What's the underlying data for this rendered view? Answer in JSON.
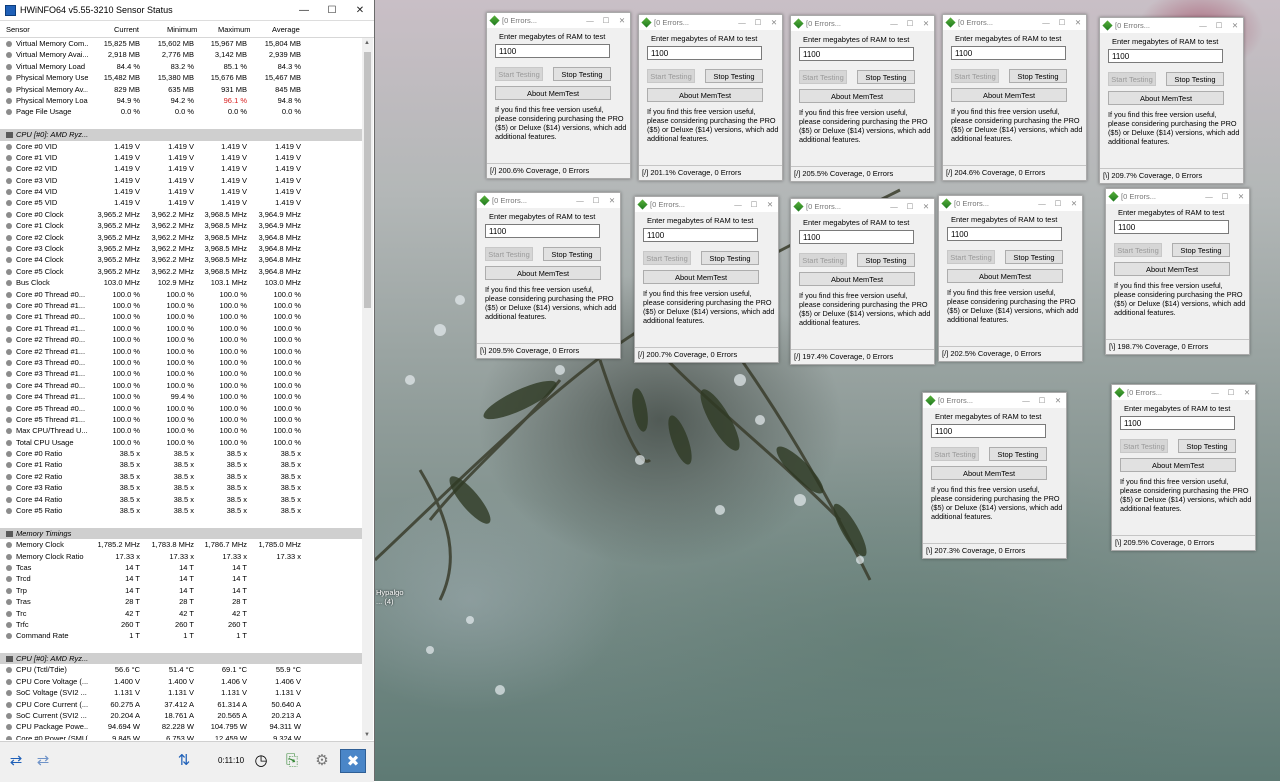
{
  "hwinfo": {
    "title": "HWiNFO64 v5.55-3210 Sensor Status",
    "columns": [
      "Sensor",
      "Current",
      "Minimum",
      "Maximum",
      "Average"
    ],
    "elapsed": "0:11:10",
    "highlight_color": "#d81e1e",
    "rows": [
      {
        "type": "sensor",
        "name": "Virtual Memory Com...",
        "cur": "15,825 MB",
        "min": "15,602 MB",
        "max": "15,967 MB",
        "avg": "15,804 MB"
      },
      {
        "type": "sensor",
        "name": "Virtual Memory Avai...",
        "cur": "2,918 MB",
        "min": "2,776 MB",
        "max": "3,142 MB",
        "avg": "2,939 MB"
      },
      {
        "type": "sensor",
        "name": "Virtual Memory Load",
        "cur": "84.4 %",
        "min": "83.2 %",
        "max": "85.1 %",
        "avg": "84.3 %"
      },
      {
        "type": "sensor",
        "name": "Physical Memory Used",
        "cur": "15,482 MB",
        "min": "15,380 MB",
        "max": "15,676 MB",
        "avg": "15,467 MB"
      },
      {
        "type": "sensor",
        "name": "Physical Memory Av...",
        "cur": "829 MB",
        "min": "635 MB",
        "max": "931 MB",
        "avg": "845 MB"
      },
      {
        "type": "sensor",
        "name": "Physical Memory Load",
        "cur": "94.9 %",
        "min": "94.2 %",
        "max": "96.1 %",
        "avg": "94.8 %",
        "max_red": true
      },
      {
        "type": "sensor",
        "name": "Page File Usage",
        "cur": "0.0 %",
        "min": "0.0 %",
        "max": "0.0 %",
        "avg": "0.0 %"
      },
      {
        "type": "blank"
      },
      {
        "type": "group",
        "name": "CPU [#0]: AMD Ryz..."
      },
      {
        "type": "sensor",
        "name": "Core #0 VID",
        "cur": "1.419 V",
        "min": "1.419 V",
        "max": "1.419 V",
        "avg": "1.419 V"
      },
      {
        "type": "sensor",
        "name": "Core #1 VID",
        "cur": "1.419 V",
        "min": "1.419 V",
        "max": "1.419 V",
        "avg": "1.419 V"
      },
      {
        "type": "sensor",
        "name": "Core #2 VID",
        "cur": "1.419 V",
        "min": "1.419 V",
        "max": "1.419 V",
        "avg": "1.419 V"
      },
      {
        "type": "sensor",
        "name": "Core #3 VID",
        "cur": "1.419 V",
        "min": "1.419 V",
        "max": "1.419 V",
        "avg": "1.419 V"
      },
      {
        "type": "sensor",
        "name": "Core #4 VID",
        "cur": "1.419 V",
        "min": "1.419 V",
        "max": "1.419 V",
        "avg": "1.419 V"
      },
      {
        "type": "sensor",
        "name": "Core #5 VID",
        "cur": "1.419 V",
        "min": "1.419 V",
        "max": "1.419 V",
        "avg": "1.419 V"
      },
      {
        "type": "sensor",
        "name": "Core #0 Clock",
        "cur": "3,965.2 MHz",
        "min": "3,962.2 MHz",
        "max": "3,968.5 MHz",
        "avg": "3,964.9 MHz"
      },
      {
        "type": "sensor",
        "name": "Core #1 Clock",
        "cur": "3,965.2 MHz",
        "min": "3,962.2 MHz",
        "max": "3,968.5 MHz",
        "avg": "3,964.9 MHz"
      },
      {
        "type": "sensor",
        "name": "Core #2 Clock",
        "cur": "3,965.2 MHz",
        "min": "3,962.2 MHz",
        "max": "3,968.5 MHz",
        "avg": "3,964.8 MHz"
      },
      {
        "type": "sensor",
        "name": "Core #3 Clock",
        "cur": "3,965.2 MHz",
        "min": "3,962.2 MHz",
        "max": "3,968.5 MHz",
        "avg": "3,964.8 MHz"
      },
      {
        "type": "sensor",
        "name": "Core #4 Clock",
        "cur": "3,965.2 MHz",
        "min": "3,962.2 MHz",
        "max": "3,968.5 MHz",
        "avg": "3,964.8 MHz"
      },
      {
        "type": "sensor",
        "name": "Core #5 Clock",
        "cur": "3,965.2 MHz",
        "min": "3,962.2 MHz",
        "max": "3,968.5 MHz",
        "avg": "3,964.8 MHz"
      },
      {
        "type": "sensor",
        "name": "Bus Clock",
        "cur": "103.0 MHz",
        "min": "102.9 MHz",
        "max": "103.1 MHz",
        "avg": "103.0 MHz"
      },
      {
        "type": "sensor",
        "name": "Core #0 Thread #0...",
        "cur": "100.0 %",
        "min": "100.0 %",
        "max": "100.0 %",
        "avg": "100.0 %"
      },
      {
        "type": "sensor",
        "name": "Core #0 Thread #1...",
        "cur": "100.0 %",
        "min": "100.0 %",
        "max": "100.0 %",
        "avg": "100.0 %"
      },
      {
        "type": "sensor",
        "name": "Core #1 Thread #0...",
        "cur": "100.0 %",
        "min": "100.0 %",
        "max": "100.0 %",
        "avg": "100.0 %"
      },
      {
        "type": "sensor",
        "name": "Core #1 Thread #1...",
        "cur": "100.0 %",
        "min": "100.0 %",
        "max": "100.0 %",
        "avg": "100.0 %"
      },
      {
        "type": "sensor",
        "name": "Core #2 Thread #0...",
        "cur": "100.0 %",
        "min": "100.0 %",
        "max": "100.0 %",
        "avg": "100.0 %"
      },
      {
        "type": "sensor",
        "name": "Core #2 Thread #1...",
        "cur": "100.0 %",
        "min": "100.0 %",
        "max": "100.0 %",
        "avg": "100.0 %"
      },
      {
        "type": "sensor",
        "name": "Core #3 Thread #0...",
        "cur": "100.0 %",
        "min": "100.0 %",
        "max": "100.0 %",
        "avg": "100.0 %"
      },
      {
        "type": "sensor",
        "name": "Core #3 Thread #1...",
        "cur": "100.0 %",
        "min": "100.0 %",
        "max": "100.0 %",
        "avg": "100.0 %"
      },
      {
        "type": "sensor",
        "name": "Core #4 Thread #0...",
        "cur": "100.0 %",
        "min": "100.0 %",
        "max": "100.0 %",
        "avg": "100.0 %"
      },
      {
        "type": "sensor",
        "name": "Core #4 Thread #1...",
        "cur": "100.0 %",
        "min": "99.4 %",
        "max": "100.0 %",
        "avg": "100.0 %"
      },
      {
        "type": "sensor",
        "name": "Core #5 Thread #0...",
        "cur": "100.0 %",
        "min": "100.0 %",
        "max": "100.0 %",
        "avg": "100.0 %"
      },
      {
        "type": "sensor",
        "name": "Core #5 Thread #1...",
        "cur": "100.0 %",
        "min": "100.0 %",
        "max": "100.0 %",
        "avg": "100.0 %"
      },
      {
        "type": "sensor",
        "name": "Max CPU/Thread U...",
        "cur": "100.0 %",
        "min": "100.0 %",
        "max": "100.0 %",
        "avg": "100.0 %"
      },
      {
        "type": "sensor",
        "name": "Total CPU Usage",
        "cur": "100.0 %",
        "min": "100.0 %",
        "max": "100.0 %",
        "avg": "100.0 %"
      },
      {
        "type": "sensor",
        "name": "Core #0 Ratio",
        "cur": "38.5 x",
        "min": "38.5 x",
        "max": "38.5 x",
        "avg": "38.5 x"
      },
      {
        "type": "sensor",
        "name": "Core #1 Ratio",
        "cur": "38.5 x",
        "min": "38.5 x",
        "max": "38.5 x",
        "avg": "38.5 x"
      },
      {
        "type": "sensor",
        "name": "Core #2 Ratio",
        "cur": "38.5 x",
        "min": "38.5 x",
        "max": "38.5 x",
        "avg": "38.5 x"
      },
      {
        "type": "sensor",
        "name": "Core #3 Ratio",
        "cur": "38.5 x",
        "min": "38.5 x",
        "max": "38.5 x",
        "avg": "38.5 x"
      },
      {
        "type": "sensor",
        "name": "Core #4 Ratio",
        "cur": "38.5 x",
        "min": "38.5 x",
        "max": "38.5 x",
        "avg": "38.5 x"
      },
      {
        "type": "sensor",
        "name": "Core #5 Ratio",
        "cur": "38.5 x",
        "min": "38.5 x",
        "max": "38.5 x",
        "avg": "38.5 x"
      },
      {
        "type": "blank"
      },
      {
        "type": "group",
        "name": "Memory Timings"
      },
      {
        "type": "sensor",
        "name": "Memory Clock",
        "cur": "1,785.2 MHz",
        "min": "1,783.8 MHz",
        "max": "1,786.7 MHz",
        "avg": "1,785.0 MHz"
      },
      {
        "type": "sensor",
        "name": "Memory Clock Ratio",
        "cur": "17.33 x",
        "min": "17.33 x",
        "max": "17.33 x",
        "avg": "17.33 x"
      },
      {
        "type": "sensor",
        "name": "Tcas",
        "cur": "14 T",
        "min": "14 T",
        "max": "14 T",
        "avg": ""
      },
      {
        "type": "sensor",
        "name": "Trcd",
        "cur": "14 T",
        "min": "14 T",
        "max": "14 T",
        "avg": ""
      },
      {
        "type": "sensor",
        "name": "Trp",
        "cur": "14 T",
        "min": "14 T",
        "max": "14 T",
        "avg": ""
      },
      {
        "type": "sensor",
        "name": "Tras",
        "cur": "28 T",
        "min": "28 T",
        "max": "28 T",
        "avg": ""
      },
      {
        "type": "sensor",
        "name": "Trc",
        "cur": "42 T",
        "min": "42 T",
        "max": "42 T",
        "avg": ""
      },
      {
        "type": "sensor",
        "name": "Trfc",
        "cur": "260 T",
        "min": "260 T",
        "max": "260 T",
        "avg": ""
      },
      {
        "type": "sensor",
        "name": "Command Rate",
        "cur": "1 T",
        "min": "1 T",
        "max": "1 T",
        "avg": ""
      },
      {
        "type": "blank"
      },
      {
        "type": "group",
        "name": "CPU [#0]: AMD Ryz..."
      },
      {
        "type": "sensor",
        "name": "CPU (Tctl/Tdie)",
        "cur": "56.6 °C",
        "min": "51.4 °C",
        "max": "69.1 °C",
        "avg": "55.9 °C"
      },
      {
        "type": "sensor",
        "name": "CPU Core Voltage (...",
        "cur": "1.400 V",
        "min": "1.400 V",
        "max": "1.406 V",
        "avg": "1.406 V"
      },
      {
        "type": "sensor",
        "name": "SoC Voltage (SVI2 ...",
        "cur": "1.131 V",
        "min": "1.131 V",
        "max": "1.131 V",
        "avg": "1.131 V"
      },
      {
        "type": "sensor",
        "name": "CPU Core Current (...",
        "cur": "60.275 A",
        "min": "37.412 A",
        "max": "61.314 A",
        "avg": "50.640 A"
      },
      {
        "type": "sensor",
        "name": "SoC Current (SVI2 ...",
        "cur": "20.204 A",
        "min": "18.761 A",
        "max": "20.565 A",
        "avg": "20.213 A"
      },
      {
        "type": "sensor",
        "name": "CPU Package Powe...",
        "cur": "94.694 W",
        "min": "82.228 W",
        "max": "104.795 W",
        "avg": "94.311 W"
      },
      {
        "type": "sensor",
        "name": "Core #0 Power (SMU)",
        "cur": "9.845 W",
        "min": "6.753 W",
        "max": "12.459 W",
        "avg": "9.324 W"
      }
    ]
  },
  "desktop": {
    "icon_label": "Hypalgo\n... (4)"
  },
  "memtest_common": {
    "prompt": "Enter megabytes of RAM to test",
    "start_label": "Start Testing",
    "stop_label": "Stop Testing",
    "about_label": "About MemTest",
    "info": "If you find this free version useful, please considering purchasing the PRO ($5) or Deluxe ($14) versions, which add additional features."
  },
  "memtest_windows": [
    {
      "title": "[0 Errors...",
      "value": "1100",
      "status": "[/]  200.6% Coverage, 0 Errors"
    },
    {
      "title": "[0 Errors...",
      "value": "1100",
      "status": "[/]  201.1% Coverage, 0 Errors"
    },
    {
      "title": "[0 Errors...",
      "value": "1100",
      "status": "[/]  205.5% Coverage, 0 Errors"
    },
    {
      "title": "[0 Errors...",
      "value": "1100",
      "status": "[/]  204.6% Coverage, 0 Errors"
    },
    {
      "title": "[0 Errors...",
      "value": "1100",
      "status": "[\\]  209.7% Coverage, 0 Errors"
    },
    {
      "title": "[0 Errors...",
      "value": "1100",
      "status": "[\\]  209.5% Coverage, 0 Errors"
    },
    {
      "title": "[0 Errors...",
      "value": "1100",
      "status": "[/]  200.7% Coverage, 0 Errors"
    },
    {
      "title": "[0 Errors...",
      "value": "1100",
      "status": "[/]  197.4% Coverage, 0 Errors"
    },
    {
      "title": "[0 Errors...",
      "value": "1100",
      "status": "[/]  202.5% Coverage, 0 Errors"
    },
    {
      "title": "[0 Errors...",
      "value": "1100",
      "status": "[\\]  198.7% Coverage, 0 Errors"
    },
    {
      "title": "[0 Errors...",
      "value": "1100",
      "status": "[\\]  207.3% Coverage, 0 Errors"
    },
    {
      "title": "[0 Errors...",
      "value": "1100",
      "status": "[\\]  209.5% Coverage, 0 Errors"
    }
  ]
}
